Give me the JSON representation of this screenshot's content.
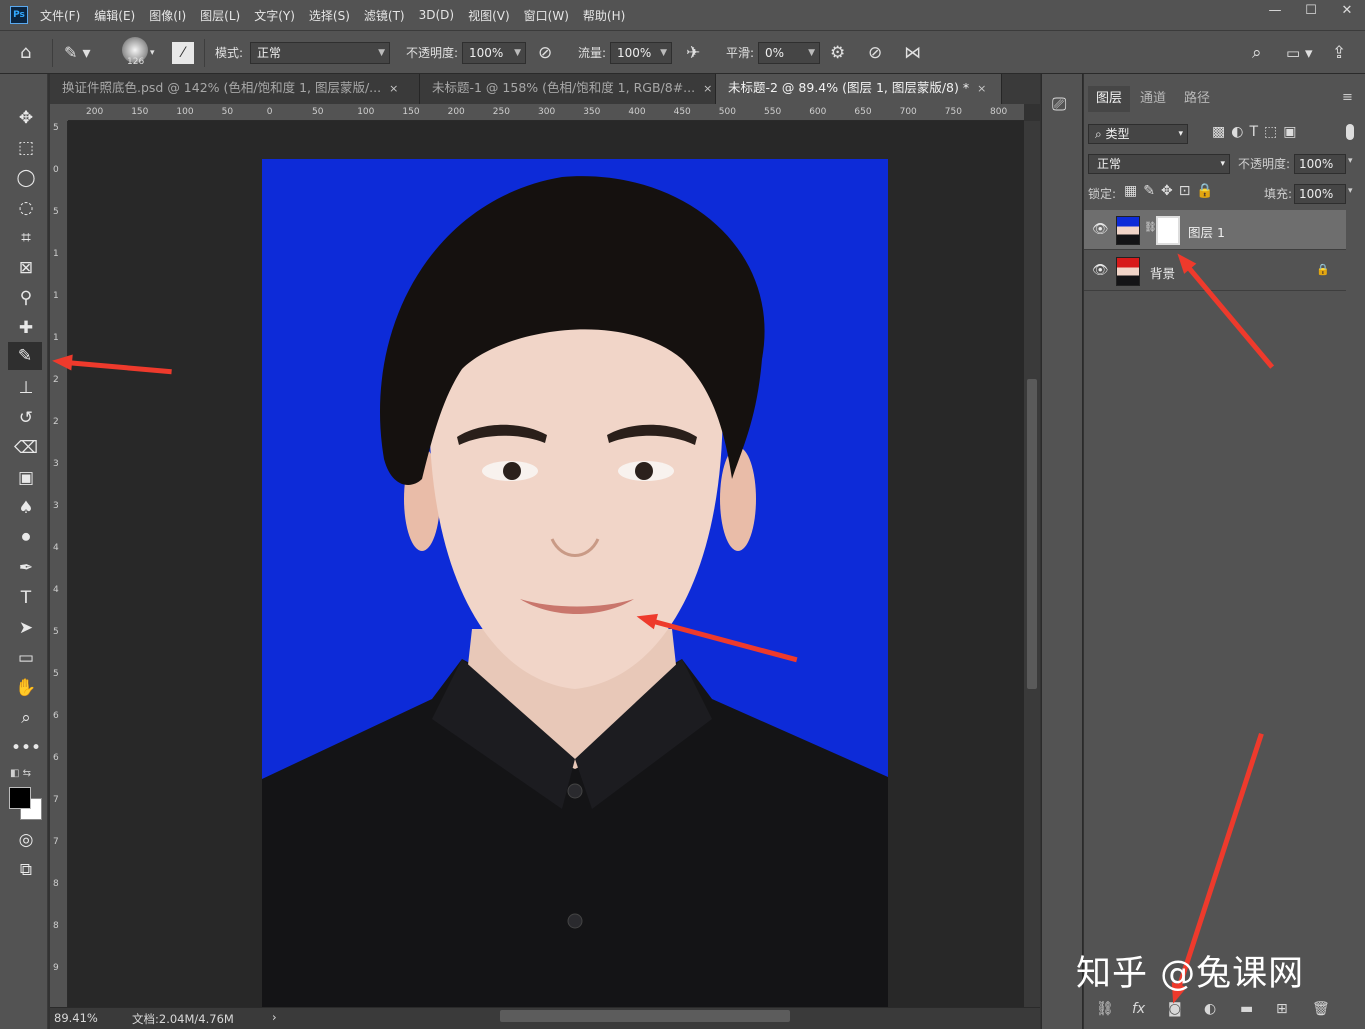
{
  "app": {
    "logo": "Ps"
  },
  "menu": [
    "文件(F)",
    "编辑(E)",
    "图像(I)",
    "图层(L)",
    "文字(Y)",
    "选择(S)",
    "滤镜(T)",
    "3D(D)",
    "视图(V)",
    "窗口(W)",
    "帮助(H)"
  ],
  "window_controls": [
    "—",
    "☐",
    "✕"
  ],
  "options": {
    "brush_size": "126",
    "mode_label": "模式:",
    "mode_value": "正常",
    "opacity_label": "不透明度:",
    "opacity_value": "100%",
    "flow_label": "流量:",
    "flow_value": "100%",
    "smoothing_label": "平滑:",
    "smoothing_value": "0%"
  },
  "tabs": [
    {
      "label": "换证件照底色.psd @ 142% (色相/饱和度 1, 图层蒙版/...",
      "close": "×"
    },
    {
      "label": "未标题-1 @ 158% (色相/饱和度 1, RGB/8#...",
      "close": "×"
    },
    {
      "label": "未标题-2 @ 89.4% (图层 1, 图层蒙版/8) *",
      "close": "×"
    }
  ],
  "ruler_h": [
    "200",
    "150",
    "100",
    "50",
    "0",
    "50",
    "100",
    "150",
    "200",
    "250",
    "300",
    "350",
    "400",
    "450",
    "500",
    "550",
    "600",
    "650",
    "700",
    "750",
    "800"
  ],
  "ruler_v": [
    "5",
    "0",
    "5",
    "1",
    "1",
    "1",
    "2",
    "2",
    "3",
    "3",
    "4",
    "4",
    "5",
    "5",
    "6",
    "6",
    "7",
    "7",
    "8",
    "8",
    "9"
  ],
  "status": {
    "zoom": "89.41%",
    "doc": "文档:2.04M/4.76M",
    "arrow": "›"
  },
  "panel": {
    "tabs": [
      "图层",
      "通道",
      "路径"
    ],
    "filter_label": "类型",
    "blend_mode": "正常",
    "opacity_label": "不透明度:",
    "opacity_value": "100%",
    "lock_label": "锁定:",
    "fill_label": "填充:",
    "fill_value": "100%",
    "layers": [
      {
        "name": "图层 1"
      },
      {
        "name": "背景"
      }
    ]
  },
  "watermark": "知乎 @兔课网",
  "colors": {
    "photo_bg": "#0d2bd8",
    "accent_arrow": "#ee3a2c"
  }
}
